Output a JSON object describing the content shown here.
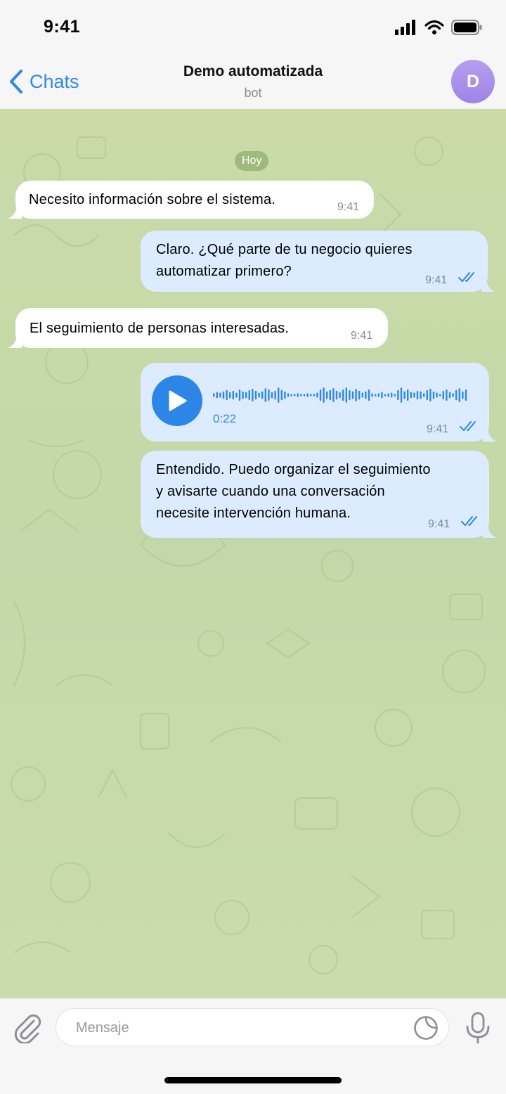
{
  "status_bar": {
    "time": "9:41",
    "icons": [
      "signal-icon",
      "wifi-icon",
      "battery-icon"
    ]
  },
  "header": {
    "back_label": "Chats",
    "title": "Demo automatizada",
    "subtitle": "bot",
    "avatar_letter": "D",
    "avatar_color": "#a58bea",
    "accent": "#2f87e6"
  },
  "date_label": "Hoy",
  "messages": [
    {
      "direction": "incoming",
      "text": "Necesito información sobre el sistema.",
      "time": "9:41"
    },
    {
      "direction": "outgoing",
      "lines": [
        "Claro. ¿Qué parte de tu negocio quieres",
        "automatizar primero?"
      ],
      "time": "9:41",
      "status": "read"
    },
    {
      "direction": "incoming",
      "text": "El seguimiento de personas interesadas.",
      "time": "9:41"
    },
    {
      "direction": "outgoing",
      "type": "voice",
      "duration": "0:22",
      "time": "9:41",
      "status": "read"
    },
    {
      "direction": "outgoing",
      "lines": [
        "Entendido. Puedo organizar el seguimiento",
        "y avisarte cuando una conversación",
        "necesite intervención humana."
      ],
      "time": "9:41",
      "status": "read"
    }
  ],
  "input": {
    "placeholder": "Mensaje",
    "value": ""
  },
  "colors": {
    "incoming_bubble": "#ffffff",
    "outgoing_bubble": "#dcecfe",
    "wallpaper": "#c7dba9"
  }
}
